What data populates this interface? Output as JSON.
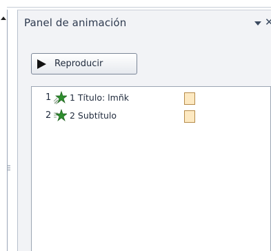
{
  "pane": {
    "title": "Panel de animación",
    "menu_icon": "dropdown-arrow-icon",
    "close_label": "✕"
  },
  "toolbar": {
    "play_label": "Reproducir",
    "play_icon": "play-icon"
  },
  "animations": [
    {
      "number": "1",
      "icon": "entrance-star-icon",
      "label": "1 Título: lmñk",
      "timing_color": "#fde9c2"
    },
    {
      "number": "2",
      "icon": "entrance-star-icon",
      "label": "2 Subtítulo",
      "timing_color": "#fde9c2"
    }
  ],
  "colors": {
    "pane_background": "#f2f3f6",
    "title_text": "#2e3a4f",
    "timing_bar_fill": "#fde9c2",
    "timing_bar_border": "#b58a48",
    "star_green": "#2f8f2f"
  }
}
